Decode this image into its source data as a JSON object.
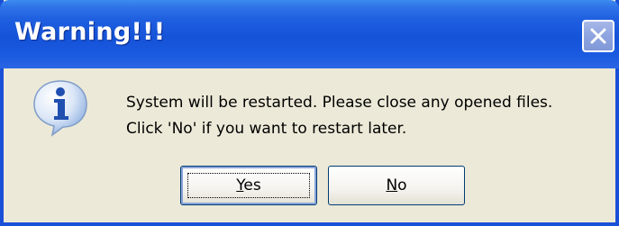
{
  "dialog": {
    "title": "Warning!!!",
    "message_line1": "System will be restarted. Please close any opened files.",
    "message_line2": "Click 'No' if you want to restart later.",
    "icon": "info-icon"
  },
  "buttons": {
    "yes_mnemonic": "Y",
    "yes_rest": "es",
    "no_mnemonic": "N",
    "no_rest": "o"
  },
  "colors": {
    "titlebar": "#1553d8",
    "dialog_background": "#ece9d8",
    "close_button": "#8ea4e0"
  }
}
